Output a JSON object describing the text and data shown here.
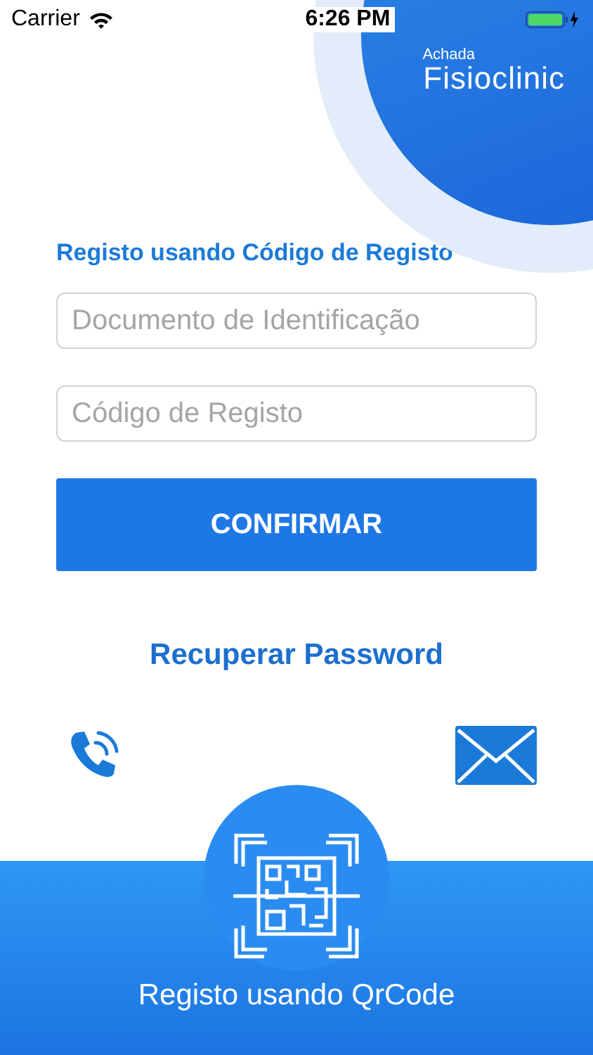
{
  "status_bar": {
    "carrier": "Carrier",
    "time": "6:26 PM"
  },
  "logo": {
    "small": "Achada",
    "large": "Fisioclinic"
  },
  "heading": "Registo usando Código de Registo",
  "fields": [
    {
      "placeholder": "Documento de Identificação"
    },
    {
      "placeholder": "Código de Registo"
    }
  ],
  "confirm_button": "CONFIRMAR",
  "recover_link": "Recuperar Password",
  "qr_button": "Registo usando QrCode"
}
